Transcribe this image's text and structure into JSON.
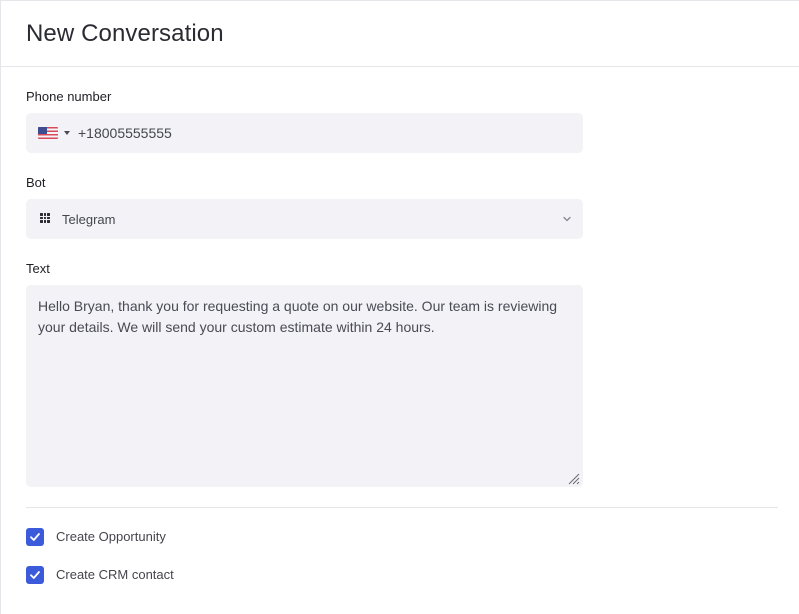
{
  "header": {
    "title": "New Conversation"
  },
  "phone": {
    "label": "Phone number",
    "country_icon": "us-flag-icon",
    "value": "+18005555555"
  },
  "bot": {
    "label": "Bot",
    "icon": "grid-icon",
    "value": "Telegram"
  },
  "text": {
    "label": "Text",
    "value": "Hello Bryan, thank you for requesting a quote on our website. Our team is reviewing your details. We will send your custom estimate within 24 hours."
  },
  "options": [
    {
      "label": "Create Opportunity",
      "checked": true
    },
    {
      "label": "Create CRM contact",
      "checked": true
    }
  ],
  "colors": {
    "accent": "#3b5bdb",
    "field_bg": "#f2f2f7",
    "border": "#e6e6ea"
  }
}
